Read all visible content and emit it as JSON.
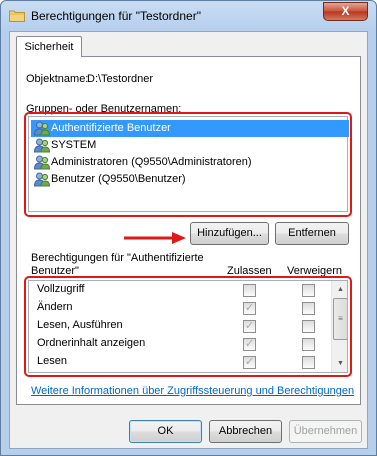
{
  "window": {
    "title": "Berechtigungen für \"Testordner\"",
    "close_label": "X"
  },
  "tab": {
    "label": "Sicherheit"
  },
  "object": {
    "label": "Objektname:",
    "value": "D:\\Testordner"
  },
  "groups": {
    "label": "Gruppen- oder Benutzernamen:",
    "items": [
      {
        "label": "Authentifizierte Benutzer",
        "selected": true
      },
      {
        "label": "SYSTEM"
      },
      {
        "label": "Administratoren (Q9550\\Administratoren)"
      },
      {
        "label": "Benutzer (Q9550\\Benutzer)"
      }
    ]
  },
  "buttons": {
    "add": "Hinzufügen...",
    "remove": "Entfernen",
    "ok": "OK",
    "cancel": "Abbrechen",
    "apply": "Übernehmen"
  },
  "permissions": {
    "header_line1": "Berechtigungen für \"Authentifizierte",
    "header_line2": "Benutzer\"",
    "col_allow": "Zulassen",
    "col_deny": "Verweigern",
    "rows": [
      {
        "label": "Vollzugriff",
        "allow": false,
        "deny": false
      },
      {
        "label": "Ändern",
        "allow": true,
        "deny": false
      },
      {
        "label": "Lesen, Ausführen",
        "allow": true,
        "deny": false
      },
      {
        "label": "Ordnerinhalt anzeigen",
        "allow": true,
        "deny": false
      },
      {
        "label": "Lesen",
        "allow": true,
        "deny": false
      },
      {
        "label": "",
        "allow": false,
        "deny": false
      }
    ]
  },
  "link": {
    "text": "Weitere Informationen über Zugriffssteuerung und Berechtigungen"
  },
  "colors": {
    "highlight": "#3399ff",
    "annotation": "#e01818",
    "link": "#0066cc"
  }
}
